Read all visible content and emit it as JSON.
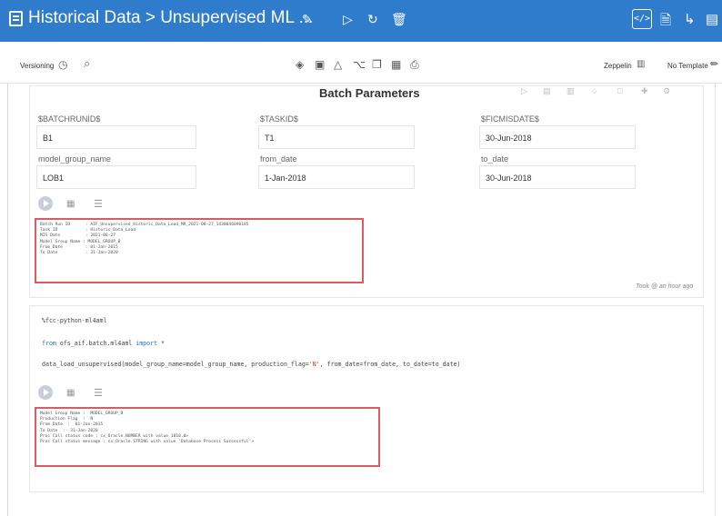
{
  "header": {
    "title": "Historical Data > Unsupervised ML ..."
  },
  "toolbar": {
    "versioning_label": "Versioning",
    "zeppelin_label": "Zeppelin",
    "template_label": "No Template"
  },
  "paragraph1": {
    "heading": "Batch Parameters",
    "fields": [
      {
        "label": "$BATCHRUNID$",
        "value": "B1"
      },
      {
        "label": "$TASKID$",
        "value": "T1"
      },
      {
        "label": "$FICMISDATE$",
        "value": "30-Jun-2018"
      },
      {
        "label": "model_group_name",
        "value": "LOB1"
      },
      {
        "label": "from_date",
        "value": "1-Jan-2018"
      },
      {
        "label": "to_date",
        "value": "30-Jun-2018"
      }
    ],
    "output_lines": [
      "Batch Run ID      : AIF_Unsupervised_Historic_Data_Load_MR_2021-08-27_1430046890185",
      "Task ID           : Historic_Data_Load",
      "MIS Date          : 2021-08-27",
      "Model Group Name : MODEL_GROUP_B",
      "From Date         : 01-Jan-2015",
      "To Date           : 31-Jan-2020"
    ],
    "elapsed": "Took @ an hour ago"
  },
  "paragraph2": {
    "code_magic": "%fcc-python-ml4aml",
    "code_import_from": "from",
    "code_import_module": " ofs_aif.batch.ml4aml ",
    "code_import_kw": "import",
    "code_import_rest": " *",
    "code_call_1": "data_load_unsupervised(model_group_name=model_group_name, production_flag=",
    "code_call_str": "'N'",
    "code_call_2": ", from_date=from_date, to_date=to_date)",
    "output_lines": [
      "Model Group Name :  MODEL_GROUP_B",
      "Production Flag  :  N",
      "From Date  :  01-Jan-2015",
      "To Date  :  31-Jan-2020",
      "Proc Call status code : cx_Oracle.NUMBER with value 1010.0>",
      "Proc Call status message : cx_Oracle.STRING with value 'Database Process Successful'>"
    ]
  },
  "colors": {
    "header_bg": "#2f7ccc",
    "highlight": "#e0595e"
  }
}
